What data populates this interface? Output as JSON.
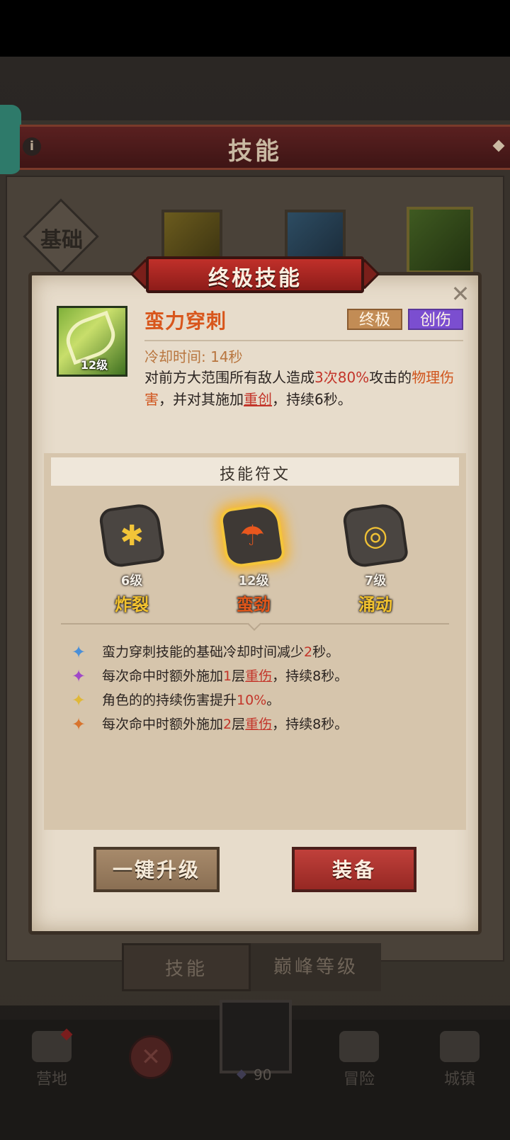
{
  "back": {
    "header_title": "技能",
    "info_icon": "i",
    "basic_label": "基础",
    "tabs": [
      "技能",
      "巅峰等级"
    ]
  },
  "nav": {
    "camp": "营地",
    "adventure": "冒险",
    "town": "城镇",
    "close": "✕",
    "gem_count": "90"
  },
  "popup": {
    "banner_title": "终极技能",
    "close": "✕",
    "skill": {
      "name": "蛮力穿刺",
      "level": "12级",
      "tags": [
        "终极",
        "创伤"
      ],
      "cooldown": "冷却时间: 14秒",
      "desc_parts": [
        "对前方大范围所有敌人造成",
        "3次",
        "80%",
        "攻击的",
        "物理伤害",
        "，并对其施加",
        "重创",
        "，持续6秒。"
      ]
    },
    "runes": {
      "title": "技能符文",
      "items": [
        {
          "glyph": "✱",
          "level": "6级",
          "name": "炸裂"
        },
        {
          "glyph": "☂",
          "level": "12级",
          "name": "蛮劲"
        },
        {
          "glyph": "◎",
          "level": "7级",
          "name": "涌动"
        }
      ]
    },
    "effects": [
      {
        "color": "#4a8fd8",
        "parts": [
          "蛮力穿刺技能的基础冷却时间减少",
          "2",
          "秒。"
        ]
      },
      {
        "color": "#a048c8",
        "parts": [
          "每次命中时额外施加",
          "1",
          "层",
          "重伤",
          "，持续8秒。"
        ]
      },
      {
        "color": "#e0b838",
        "parts": [
          "角色的的持续伤害提升",
          "10%",
          "。"
        ]
      },
      {
        "color": "#d8742e",
        "parts": [
          "每次命中时额外施加",
          "2",
          "层",
          "重伤",
          "，持续8秒。"
        ]
      }
    ],
    "buttons": {
      "upgrade": "一键升级",
      "equip": "装备"
    }
  }
}
